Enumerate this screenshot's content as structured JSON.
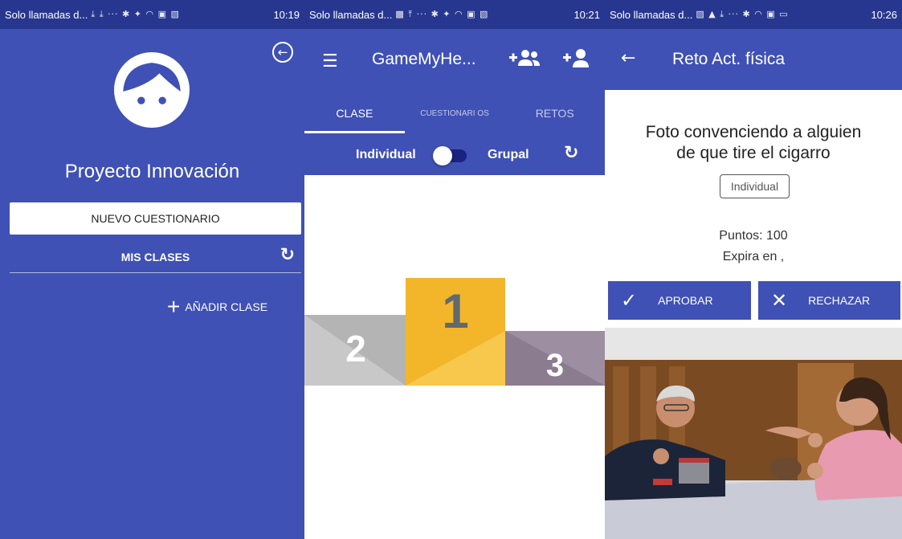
{
  "statusbars": [
    {
      "carrier": "Solo llamadas d...",
      "icons": "⤓ ⤓ ··· ✱ ✦ ◠ ▣ ▧",
      "time": "10:19"
    },
    {
      "carrier": "Solo llamadas d...",
      "icons": "▩ ⤒ ··· ✱ ✦ ◠ ▣ ▧",
      "time": "10:21"
    },
    {
      "carrier": "Solo llamadas d...",
      "icons": "▨ ▲ ⤓ ··· ✱ ◠ ▣ ▭",
      "time": "10:26"
    }
  ],
  "screen1": {
    "project_name": "Proyecto Innovación",
    "new_quiz_label": "NUEVO CUESTIONARIO",
    "my_classes_label": "MIS CLASES",
    "add_class_label": "AÑADIR CLASE"
  },
  "screen2": {
    "title": "GameMyHe...",
    "tabs": [
      {
        "label": "CLASE"
      },
      {
        "label": "CUESTIONARI OS"
      },
      {
        "label": "RETOS"
      }
    ],
    "toggle": {
      "left_label": "Individual",
      "right_label": "Grupal",
      "on": false
    },
    "podium": {
      "first": "1",
      "second": "2",
      "third": "3"
    }
  },
  "screen3": {
    "title": "Reto Act. física",
    "challenge_line1": "Foto convenciendo a alguien",
    "challenge_line2": "de que tire el cigarro",
    "mode": "Individual",
    "points": "Puntos: 100",
    "expires": "Expira en ,",
    "approve_label": "APROBAR",
    "reject_label": "RECHAZAR"
  },
  "colors": {
    "primary": "#3f51b5",
    "status_bar": "#27378f",
    "podium_gold": "#f3b52a",
    "podium_silver": "#c8c8c8",
    "podium_bronze": "#9e8ea2"
  }
}
